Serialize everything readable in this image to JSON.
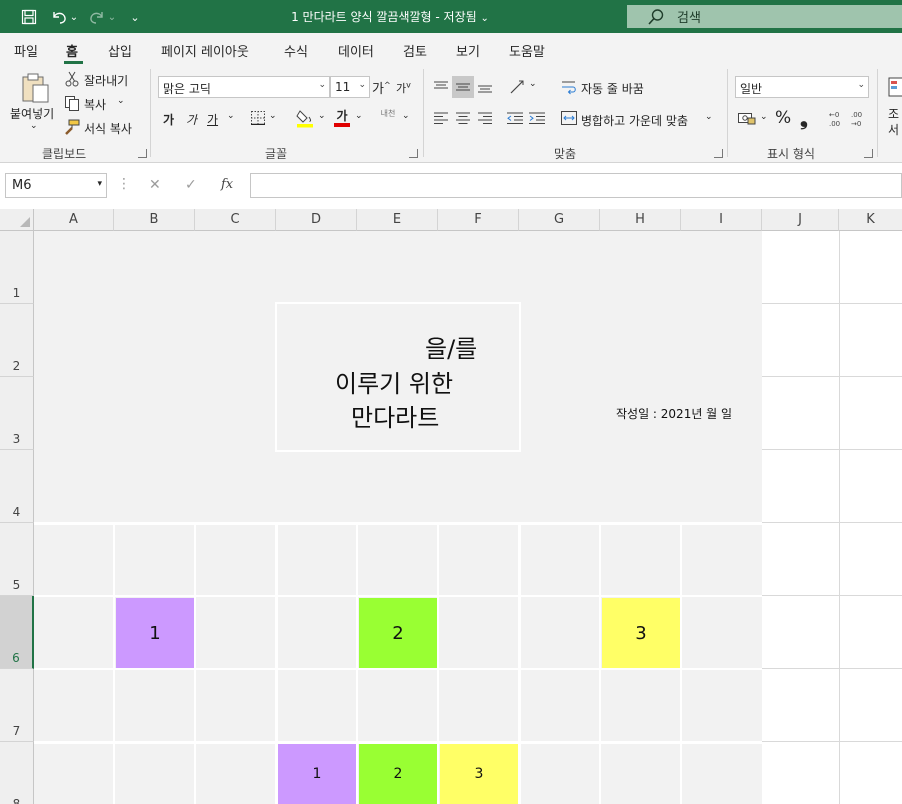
{
  "titlebar": {
    "doc_title": "1 만다라트 양식 깔끔색깔형 - 저장됨",
    "doc_title_arrow": "⌄",
    "search_label": "검색",
    "customize_glyph": "⌄"
  },
  "tabs": [
    {
      "label": "파일"
    },
    {
      "label": "홈"
    },
    {
      "label": "삽입"
    },
    {
      "label": "페이지 레이아웃"
    },
    {
      "label": "수식"
    },
    {
      "label": "데이터"
    },
    {
      "label": "검토"
    },
    {
      "label": "보기"
    },
    {
      "label": "도움말"
    }
  ],
  "ribbon": {
    "clipboard": {
      "paste_label": "붙여넣기",
      "cut_label": "잘라내기",
      "copy_label": "복사",
      "format_painter_label": "서식 복사",
      "group_label": "클립보드"
    },
    "font": {
      "font_name": "맑은 고딕",
      "font_size": "11",
      "grow_label": "가",
      "shrink_label": "가",
      "bold_label": "가",
      "italic_label": "가",
      "underline_label": "가",
      "font_color_label": "가",
      "phonetic_label": "내천",
      "group_label": "글꼴"
    },
    "alignment": {
      "wrap_label": "자동 줄 바꿈",
      "merge_label": "병합하고 가운데 맞춤",
      "group_label": "맞춤"
    },
    "number": {
      "format": "일반",
      "percent": "%",
      "comma": "❟",
      "group_label": "표시 형식"
    },
    "styles": {
      "label_line1": "조",
      "label_line2": "서"
    }
  },
  "formula_bar": {
    "name_box": "M6",
    "fx": "fx",
    "cancel": "✕",
    "enter": "✓"
  },
  "sheet": {
    "columns": [
      "A",
      "B",
      "C",
      "D",
      "E",
      "F",
      "G",
      "H",
      "I",
      "J",
      "K"
    ],
    "rows": [
      "1",
      "2",
      "3",
      "4",
      "5",
      "6",
      "7",
      "8"
    ],
    "title": {
      "line1": "을/를",
      "line2": "이루기 위한",
      "line3": "만다라트"
    },
    "date_text": "작성일 : 2021년   월   일",
    "cells": {
      "b6": "1",
      "e6": "2",
      "h6": "3",
      "d8": "1",
      "e8": "2",
      "f8": "3"
    },
    "colors": {
      "purple": "#cc99ff",
      "green": "#99ff33",
      "yellow": "#ffff66"
    }
  }
}
